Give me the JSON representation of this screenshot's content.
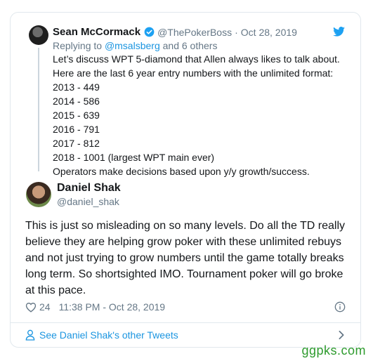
{
  "parent_tweet": {
    "name": "Sean McCormack",
    "handle": "@ThePokerBoss",
    "separator": "·",
    "date": "Oct 28, 2019",
    "replying_prefix": "Replying to",
    "replying_mention": "@msalsberg",
    "replying_suffix": "and 6 others",
    "lines": [
      "Let’s discuss WPT 5-diamond that Allen always likes to talk about.",
      "Here are the last 6 year entry numbers with the unlimited format:",
      "2013 - 449",
      "2014 - 586",
      "2015 - 639",
      "2016 - 791",
      "2017 - 812",
      "2018 - 1001 (largest WPT main ever)",
      "Operators make decisions based upon y/y growth/success."
    ]
  },
  "main_tweet": {
    "name": "Daniel Shak",
    "handle": "@daniel_shak",
    "lines": [
      "This is just so misleading on so many levels. Do all the TD really",
      "believe they are helping grow poker with these unlimited rebuys",
      "and not just trying to grow numbers until the game totally breaks",
      "long term. So shortsighted IMO. Tournament poker will go broke",
      "at this pace."
    ],
    "likes": "24",
    "timestamp": "11:38 PM - Oct 28, 2019"
  },
  "footer": {
    "see_more": "See Daniel Shak's other Tweets"
  },
  "watermark": "ggpks.com",
  "colors": {
    "accent": "#1b95e0",
    "secondary_text": "#657786",
    "border": "#e1e8ed",
    "watermark": "#2e9b2e"
  },
  "icons": [
    "verified-badge-icon",
    "twitter-bird-icon",
    "heart-icon",
    "info-icon",
    "person-icon",
    "chevron-right-icon"
  ]
}
